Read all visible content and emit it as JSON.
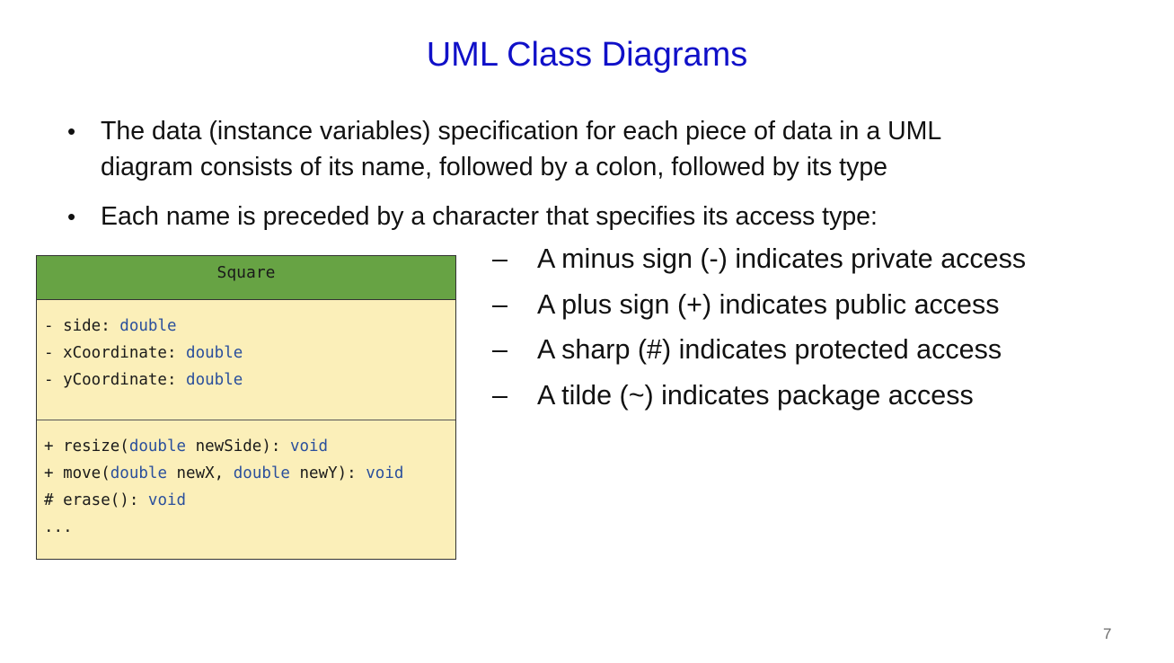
{
  "slide": {
    "title": "UML Class Diagrams",
    "page_number": "7"
  },
  "bullets": [
    {
      "line1": "The data (instance variables) specification for each piece of data in a UML",
      "line2": "diagram consists of its name,  followed by a colon, followed by its type"
    },
    {
      "line1": "Each name is preceded by a character that specifies its access type:"
    }
  ],
  "access_types": [
    "A minus sign (-) indicates private access",
    "A plus sign (+) indicates public access",
    "A sharp (#) indicates protected access",
    "A tilde (~) indicates package access"
  ],
  "uml": {
    "class_name": "Square",
    "attributes": [
      {
        "prefix": "- side: ",
        "type": "double"
      },
      {
        "prefix": "- xCoordinate: ",
        "type": "double"
      },
      {
        "prefix": "- yCoordinate: ",
        "type": "double"
      }
    ],
    "methods": [
      {
        "p1": "+ resize(",
        "t1": "double",
        "p2": " newSide): ",
        "t2": "void"
      },
      {
        "p1": "+ move(",
        "t1": "double",
        "p2": " newX, ",
        "t2": "double",
        "p3": " newY): ",
        "t3": "void"
      },
      {
        "p1": "# erase(): ",
        "t1": "void"
      }
    ],
    "ellipsis": "..."
  },
  "colors": {
    "title": "#1010c8",
    "uml_header": "#67a344",
    "uml_body": "#fbefb9",
    "uml_keyword": "#2a4f9c"
  }
}
